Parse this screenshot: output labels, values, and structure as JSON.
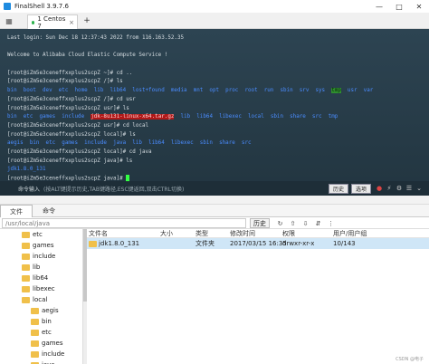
{
  "window": {
    "title": "FinalShell 3.9.7.6"
  },
  "tabs": [
    {
      "label": "1 Centos 7"
    }
  ],
  "terminal": {
    "lines": [
      [
        {
          "t": "Last login: Sun Dec 18 12:37:43 2022 from 116.163.52.35",
          "c": ""
        }
      ],
      [
        {
          "t": "",
          "c": ""
        }
      ],
      [
        {
          "t": "Welcome to Alibaba Cloud Elastic Compute Service !",
          "c": ""
        }
      ],
      [
        {
          "t": "",
          "c": ""
        }
      ],
      [
        {
          "t": "[root@iZm5e3ceneffxxplus2scpZ ~]# cd ..",
          "c": ""
        }
      ],
      [
        {
          "t": "[root@iZm5e3ceneffxxplus2scpZ /]# ls",
          "c": ""
        }
      ],
      [
        {
          "t": "bin  boot  dev  etc  home  lib  lib64  lost+found  media  mnt  opt  proc  root  run  sbin  srv  sys  ",
          "c": "c-dir"
        },
        {
          "t": "tmp",
          "c": "c-hl"
        },
        {
          "t": "  usr  var",
          "c": "c-dir"
        }
      ],
      [
        {
          "t": "[root@iZm5e3ceneffxxplus2scpZ /]# cd usr",
          "c": ""
        }
      ],
      [
        {
          "t": "[root@iZm5e3ceneffxxplus2scpZ usr]# ls",
          "c": ""
        }
      ],
      [
        {
          "t": "bin  etc  games  include  ",
          "c": "c-dir"
        },
        {
          "t": "jdk-8u131-linux-x64.tar.gz",
          "c": "c-red"
        },
        {
          "t": "  lib  lib64  libexec  local  sbin  share  src  tmp",
          "c": "c-dir"
        }
      ],
      [
        {
          "t": "[root@iZm5e3ceneffxxplus2scpZ usr]# cd local",
          "c": ""
        }
      ],
      [
        {
          "t": "[root@iZm5e3ceneffxxplus2scpZ local]# ls",
          "c": ""
        }
      ],
      [
        {
          "t": "aegis  bin  etc  games  include  java  lib  lib64  libexec  sbin  share  src",
          "c": "c-dir"
        }
      ],
      [
        {
          "t": "[root@iZm5e3ceneffxxplus2scpZ local]# cd java",
          "c": ""
        }
      ],
      [
        {
          "t": "[root@iZm5e3ceneffxxplus2scpZ java]# ls",
          "c": ""
        }
      ],
      [
        {
          "t": "jdk1.8.0_131",
          "c": "c-dir"
        }
      ],
      [
        {
          "t": "[root@iZm5e3ceneffxxplus2scpZ java]# ",
          "c": ""
        }
      ]
    ]
  },
  "cmdbar": {
    "label": "命令输入",
    "hint": "(按ALT键提示历史,TAB键路径,ESC键返回,双击CTRL切换)",
    "history_btn": "历史",
    "options_btn": "选项"
  },
  "panel_tabs": [
    "文件",
    "命令"
  ],
  "pathbar": {
    "path": "/usr/local/java",
    "history_btn": "历史"
  },
  "tree": [
    {
      "label": "etc",
      "indent": 0
    },
    {
      "label": "games",
      "indent": 0
    },
    {
      "label": "include",
      "indent": 0
    },
    {
      "label": "lib",
      "indent": 0
    },
    {
      "label": "lib64",
      "indent": 0
    },
    {
      "label": "libexec",
      "indent": 0
    },
    {
      "label": "local",
      "indent": 0
    },
    {
      "label": "aegis",
      "indent": 1
    },
    {
      "label": "bin",
      "indent": 1
    },
    {
      "label": "etc",
      "indent": 1
    },
    {
      "label": "games",
      "indent": 1
    },
    {
      "label": "include",
      "indent": 1
    },
    {
      "label": "java",
      "indent": 1
    }
  ],
  "filelist": {
    "headers": [
      "文件名",
      "大小",
      "类型",
      "修改时间",
      "权限",
      "用户/用户组"
    ],
    "rows": [
      {
        "name": "jdk1.8.0_131",
        "size": "",
        "type": "文件夹",
        "mtime": "2017/03/15 16:35",
        "perm": "drwxr-xr-x",
        "owner": "10/143"
      }
    ]
  },
  "watermark": "CSDN @电子"
}
